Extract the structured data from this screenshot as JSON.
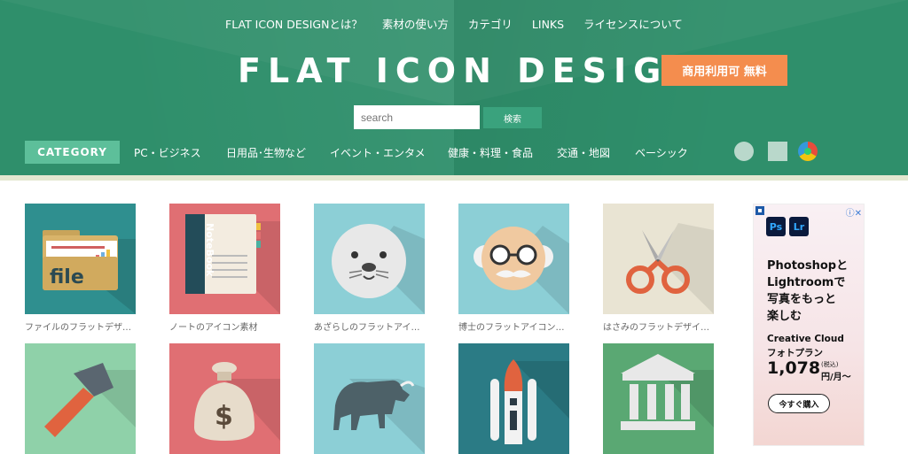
{
  "topnav": {
    "items": [
      "FLAT ICON DESIGNとは？",
      "素材の使い方",
      "カテゴリ",
      "LINKS",
      "ライセンスについて"
    ]
  },
  "brand": {
    "logo": "FLAT ICON DESIGN",
    "promo": "商用利用可 無料"
  },
  "search": {
    "placeholder": "search",
    "button": "検索"
  },
  "category_bar": {
    "label": "CATEGORY",
    "items": [
      "PC・ビジネス",
      "日用品･生物など",
      "イベント・エンタメ",
      "健康・料理・食品",
      "交通・地図",
      "ベーシック"
    ]
  },
  "icons": {
    "row1": [
      {
        "caption": "ファイルのフラットデザ…",
        "icon": "file-folder-icon",
        "bg": "#2f8f8f"
      },
      {
        "caption": "ノートのアイコン素材",
        "icon": "notebook-icon",
        "bg": "#e06f73"
      },
      {
        "caption": "あざらしのフラットアイ…",
        "icon": "seal-icon",
        "bg": "#8ccfd6"
      },
      {
        "caption": "博士のフラットアイコン…",
        "icon": "professor-icon",
        "bg": "#8ccfd6"
      },
      {
        "caption": "はさみのフラットデザイ…",
        "icon": "scissors-icon",
        "bg": "#e9e4d3"
      }
    ],
    "row2": [
      {
        "caption": "",
        "icon": "hammer-icon",
        "bg": "#8fd1a9"
      },
      {
        "caption": "",
        "icon": "money-bag-icon",
        "bg": "#e06f73"
      },
      {
        "caption": "",
        "icon": "bull-icon",
        "bg": "#8ccfd6"
      },
      {
        "caption": "",
        "icon": "space-shuttle-icon",
        "bg": "#2b7b85"
      },
      {
        "caption": "",
        "icon": "bank-building-icon",
        "bg": "#5aa873"
      }
    ]
  },
  "ad": {
    "badge_ps": "Ps",
    "badge_lr": "Lr",
    "headline_lines": [
      "Photoshopと",
      "Lightroomで",
      "写真をもっと",
      "楽しむ"
    ],
    "product": "Creative Cloud",
    "plan": "フォトプラン",
    "price": "1,078",
    "tax": "(税込)",
    "unit": "円/月～",
    "cta": "今すぐ購入",
    "adchoice": "ⓘ✕"
  },
  "colors": {
    "header": "#2f8f6b",
    "category_label": "#5dbf9a",
    "promo": "#f48d4e",
    "search_button": "#3aa27d",
    "stripe": "#e3e7d0"
  }
}
